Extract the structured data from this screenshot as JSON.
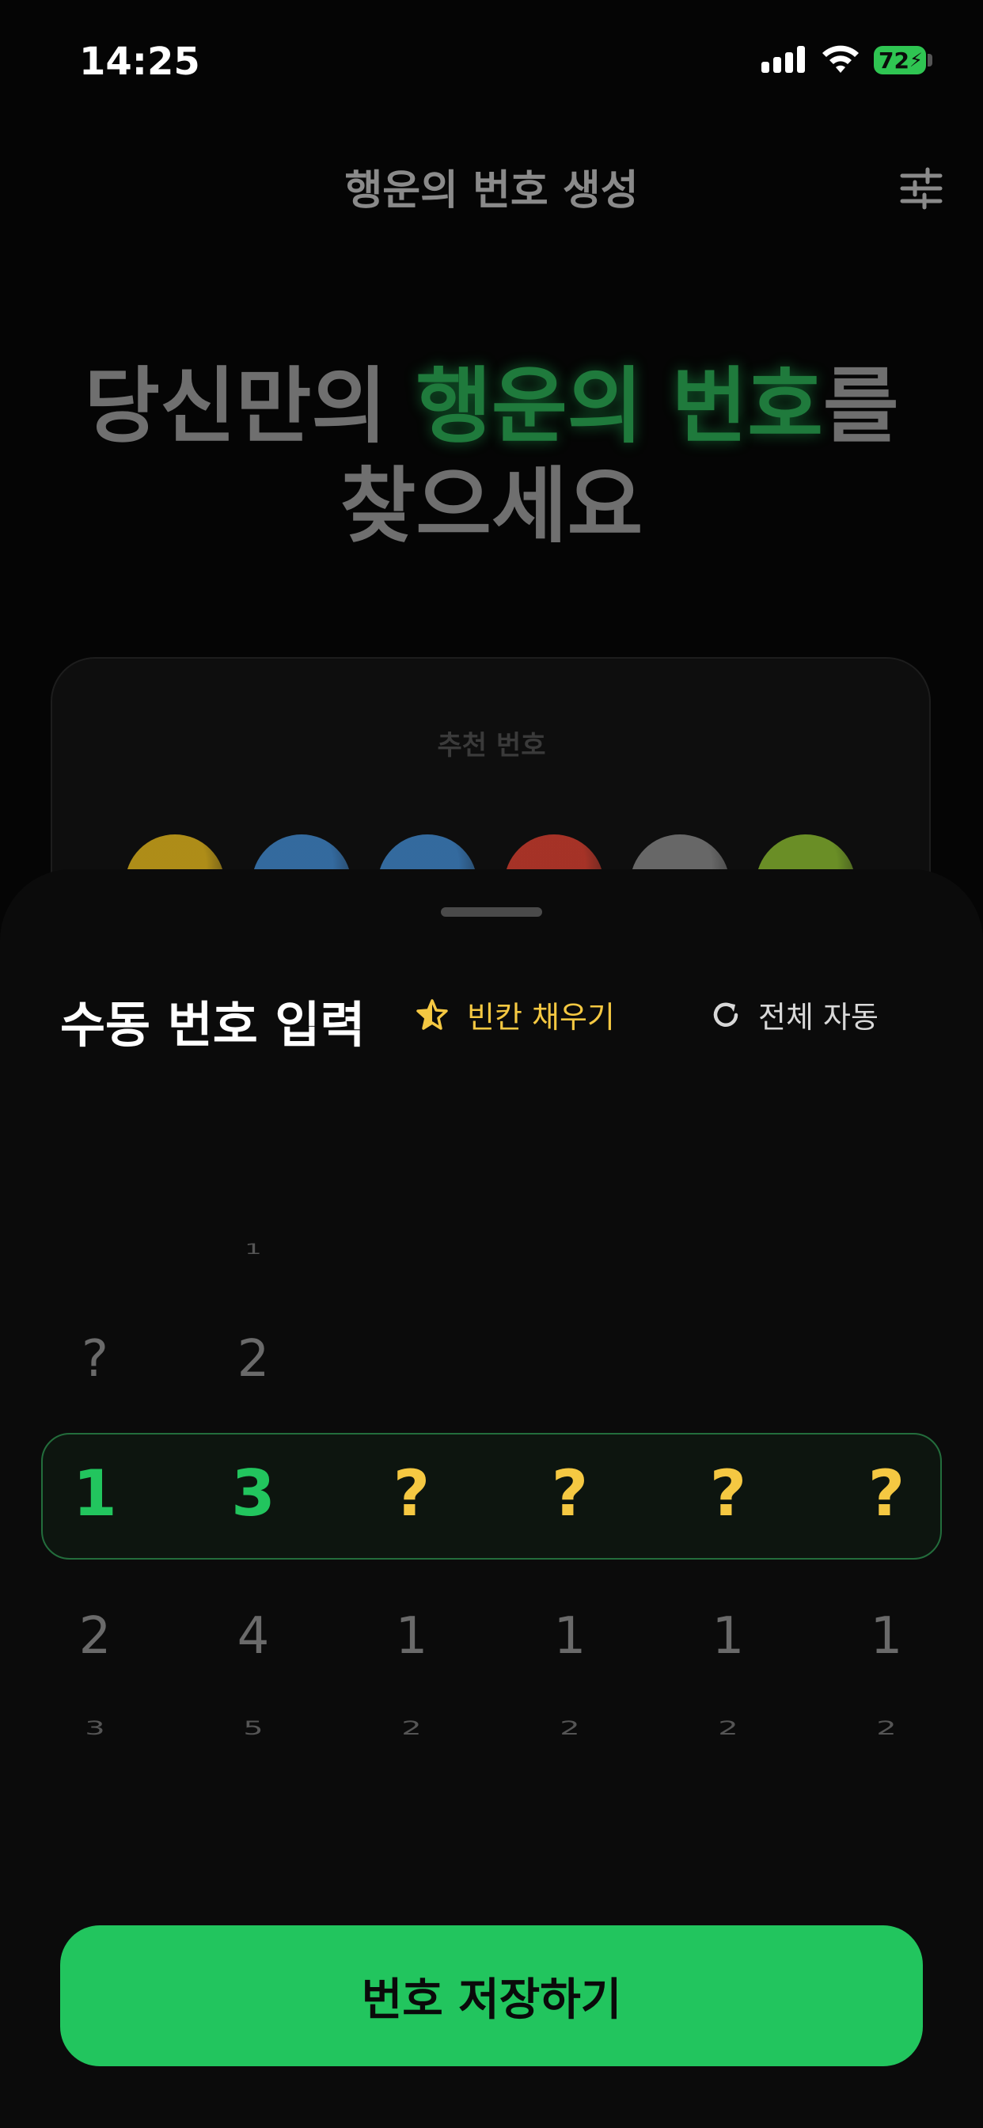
{
  "status": {
    "time": "14:25",
    "battery": "72"
  },
  "header": {
    "title": "행운의 번호 생성"
  },
  "hero": {
    "line1_pre": "당신만의 ",
    "line1_highlight": "행운의 번호",
    "line1_post": "를",
    "line2": "찾으세요"
  },
  "card": {
    "label": "추천 번호",
    "ball_colors": [
      "#caa31a",
      "#3a7ab8",
      "#3a7ab8",
      "#c0392b",
      "#777777",
      "#7aa52a"
    ]
  },
  "sheet": {
    "title": "수동 번호 입력",
    "fill_label": "빈칸 채우기",
    "auto_label": "전체 자동",
    "columns": [
      {
        "above2": "",
        "above1": "?",
        "selected": "1",
        "selected_state": "set",
        "below1": "2",
        "below2": "3"
      },
      {
        "above2": "1",
        "above1": "2",
        "selected": "3",
        "selected_state": "set",
        "below1": "4",
        "below2": "5"
      },
      {
        "above2": "",
        "above1": "",
        "selected": "?",
        "selected_state": "empty",
        "below1": "1",
        "below2": "2"
      },
      {
        "above2": "",
        "above1": "",
        "selected": "?",
        "selected_state": "empty",
        "below1": "1",
        "below2": "2"
      },
      {
        "above2": "",
        "above1": "",
        "selected": "?",
        "selected_state": "empty",
        "below1": "1",
        "below2": "2"
      },
      {
        "above2": "",
        "above1": "",
        "selected": "?",
        "selected_state": "empty",
        "below1": "1",
        "below2": "2"
      }
    ],
    "save_label": "번호 저장하기"
  },
  "colors": {
    "accent": "#22c55e",
    "warning": "#f5c842",
    "background": "#050505"
  }
}
